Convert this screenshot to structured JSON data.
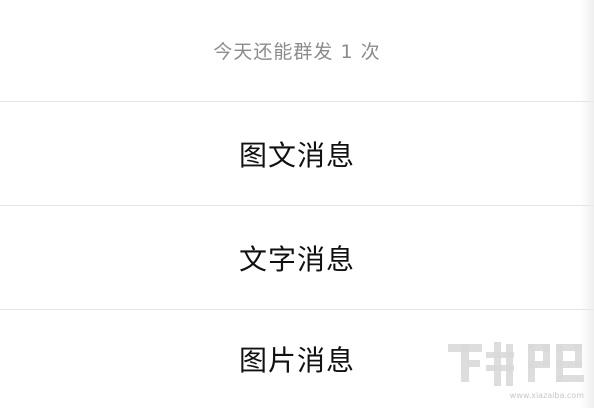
{
  "header": {
    "notice": "今天还能群发 1 次"
  },
  "options": [
    {
      "label": "图文消息"
    },
    {
      "label": "文字消息"
    },
    {
      "label": "图片消息"
    }
  ],
  "watermark": {
    "brand": "下载吧",
    "url": "www.xiazaiba.com"
  }
}
